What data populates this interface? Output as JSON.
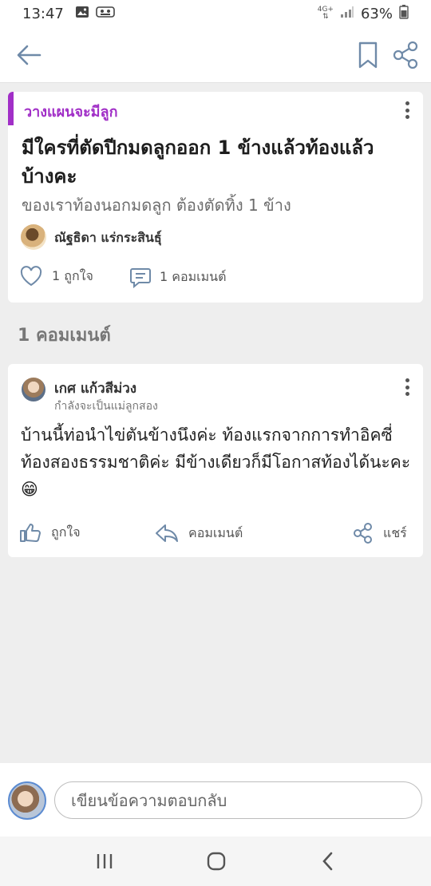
{
  "status_bar": {
    "time": "13:47",
    "network_label": "4G+",
    "battery_percent": "63%"
  },
  "header": {
    "icons": [
      "back-arrow-icon",
      "bookmark-icon",
      "share-icon"
    ]
  },
  "post": {
    "category": "วางแผนจะมีลูก",
    "title": "มีใครที่ตัดปีกมดลูกออก 1 ข้างแล้วท้องแล้วบ้างคะ",
    "subtitle": "ของเราท้องนอกมดลูก ต้องตัดทิ้ง 1 ข้าง",
    "author": "ณัฐธิดา แร่กระสินธุ์",
    "likes_label": "1 ถูกใจ",
    "comments_label": "1 คอมเมนต์"
  },
  "comments_section": {
    "heading": "1 คอมเมนต์"
  },
  "comment": {
    "name": "เกศ แก้วสีม่วง",
    "status": "กำลังจะเป็นแม่ลูกสอง",
    "body": "บ้านนี้ท่อนำไข่ตันข้างนึงค่ะ ท้องแรกจากการทำอิคซี่ ท้องสองธรรมชาติค่ะ มีข้างเดียวก็มีโอกาสท้องได้นะคะ😁",
    "like_label": "ถูกใจ",
    "comment_label": "คอมเมนต์",
    "share_label": "แชร์"
  },
  "reply": {
    "placeholder": "เขียนข้อความตอบกลับ"
  },
  "colors": {
    "accent": "#a12fc7",
    "background": "#eeeeee"
  }
}
